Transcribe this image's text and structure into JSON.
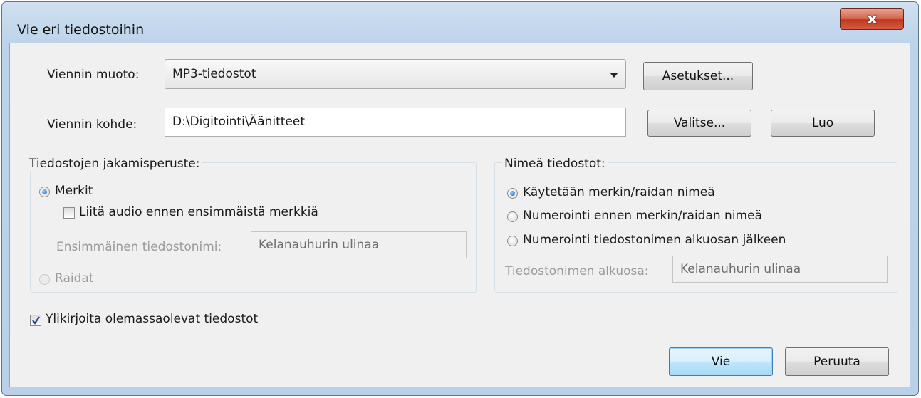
{
  "window": {
    "title": "Vie eri tiedostoihin",
    "close_label": "x"
  },
  "format": {
    "label": "Viennin muoto:",
    "selected": "MP3-tiedostot",
    "settings_button": "Asetukset..."
  },
  "destination": {
    "label": "Viennin kohde:",
    "value": "D:\\Digitointi\\Äänitteet",
    "choose_button": "Valitse...",
    "create_button": "Luo"
  },
  "split": {
    "group_label": "Tiedostojen jakamisperuste:",
    "option_labels": "Merkit",
    "option_labels_checked": true,
    "include_audio_label": "Liitä audio ennen ensimmäistä merkkiä",
    "include_audio_checked": false,
    "first_filename_label": "Ensimmäinen tiedostonimi:",
    "first_filename_value": "Kelanauhurin ulinaa",
    "option_tracks": "Raidat"
  },
  "naming": {
    "group_label": "Nimeä tiedostot:",
    "options": [
      "Käytetään merkin/raidan nimeä",
      "Numerointi ennen merkin/raidan nimeä",
      "Numerointi tiedostonimen alkuosan jälkeen"
    ],
    "selected_index": 0,
    "prefix_label": "Tiedostonimen alkuosa:",
    "prefix_value": "Kelanauhurin ulinaa"
  },
  "overwrite": {
    "label": "Ylikirjoita olemassaolevat tiedostot",
    "checked": true
  },
  "buttons": {
    "export": "Vie",
    "cancel": "Peruuta"
  }
}
